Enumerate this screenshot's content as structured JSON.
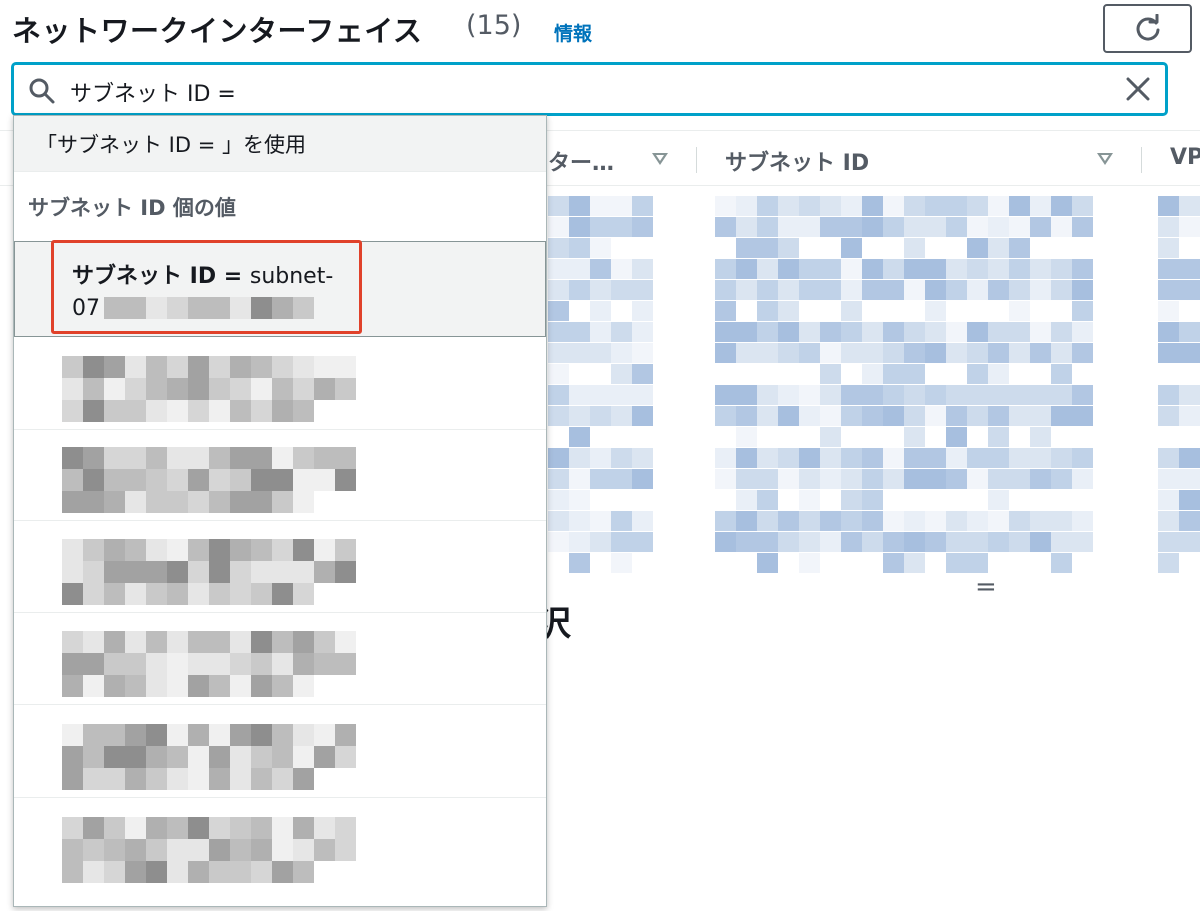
{
  "header": {
    "title": "ネットワークインターフェイス",
    "count": "(15)",
    "info_link": "情報",
    "refresh_icon": "refresh-icon"
  },
  "search": {
    "value": "サブネット ID =",
    "icon": "search-icon",
    "clear_icon": "close-icon"
  },
  "table": {
    "columns": [
      {
        "label": "ター…"
      },
      {
        "label": "サブネット ID"
      },
      {
        "label": "VP"
      }
    ]
  },
  "dropdown": {
    "use_option": "「サブネット ID = 」を使用",
    "group_label": "サブネット ID 個の値",
    "highlighted_option": {
      "prefix": "サブネット ID = ",
      "value_start": "subnet-",
      "value_line2": "07"
    },
    "redacted_option_count": 6
  },
  "background_fragments": {
    "equals": "=",
    "glyph": "沢"
  },
  "colors": {
    "accent": "#00a1c9",
    "link": "#0073bb",
    "highlight_border": "#e0412a"
  }
}
